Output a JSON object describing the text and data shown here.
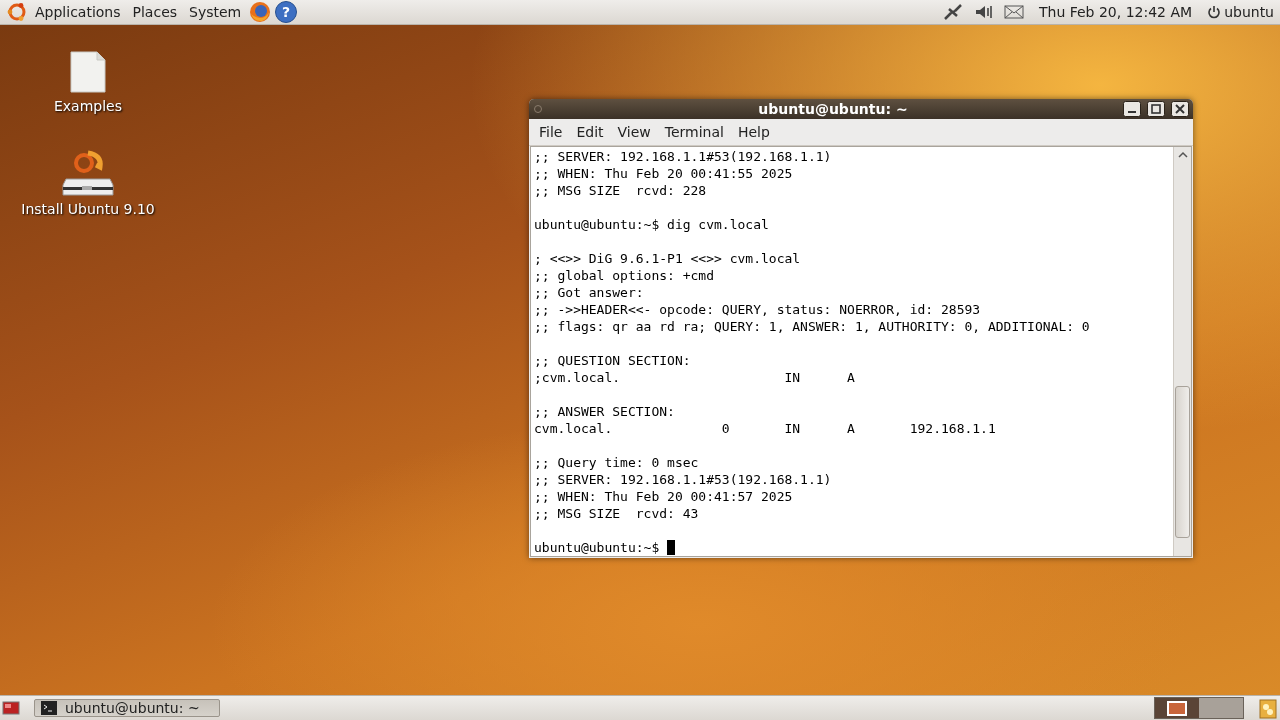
{
  "top_panel": {
    "menus": [
      "Applications",
      "Places",
      "System"
    ],
    "help_launcher": "?",
    "clock": "Thu Feb 20, 12:42 AM",
    "user": "ubuntu"
  },
  "desktop_icons": [
    {
      "kind": "document",
      "label": "Examples"
    },
    {
      "kind": "installer",
      "label": "Install Ubuntu 9.10"
    }
  ],
  "terminal": {
    "title": "ubuntu@ubuntu: ~",
    "menu": [
      "File",
      "Edit",
      "View",
      "Terminal",
      "Help"
    ],
    "blocks": [
      [
        ";; SERVER: 192.168.1.1#53(192.168.1.1)",
        ";; WHEN: Thu Feb 20 00:41:55 2025",
        ";; MSG SIZE  rcvd: 228"
      ],
      [
        "ubuntu@ubuntu:~$ dig cvm.local"
      ],
      [
        "; <<>> DiG 9.6.1-P1 <<>> cvm.local",
        ";; global options: +cmd",
        ";; Got answer:",
        ";; ->>HEADER<<- opcode: QUERY, status: NOERROR, id: 28593",
        ";; flags: qr aa rd ra; QUERY: 1, ANSWER: 1, AUTHORITY: 0, ADDITIONAL: 0"
      ],
      [
        ";; QUESTION SECTION:",
        ";cvm.local.                     IN      A"
      ],
      [
        ";; ANSWER SECTION:",
        "cvm.local.              0       IN      A       192.168.1.1"
      ],
      [
        ";; Query time: 0 msec",
        ";; SERVER: 192.168.1.1#53(192.168.1.1)",
        ";; WHEN: Thu Feb 20 00:41:57 2025",
        ";; MSG SIZE  rcvd: 43"
      ],
      [
        "ubuntu@ubuntu:~$ "
      ]
    ]
  },
  "bottom_panel": {
    "tasks": [
      {
        "label": "ubuntu@ubuntu: ~",
        "selected": true
      }
    ],
    "workspaces": [
      {
        "selected": true
      },
      {
        "selected": false
      }
    ]
  }
}
